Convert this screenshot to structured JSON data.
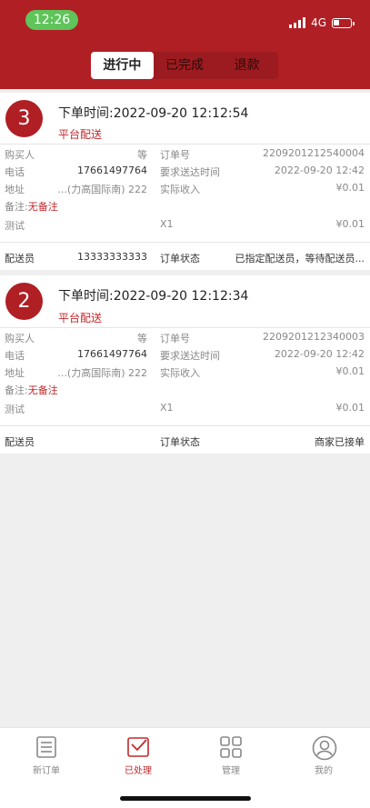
{
  "status_bar": {
    "time": "12:26",
    "network": "4G"
  },
  "tabs": [
    {
      "label": "进行中",
      "active": true
    },
    {
      "label": "已完成",
      "active": false
    },
    {
      "label": "退款",
      "active": false
    }
  ],
  "labels": {
    "buyer": "购买人",
    "phone": "电话",
    "address": "地址",
    "remark": "备注:",
    "order_no": "订单号",
    "required_time": "要求送达时间",
    "actual_income": "实际收入",
    "courier": "配送员",
    "order_status": "订单状态"
  },
  "orders": [
    {
      "number": "3",
      "order_time": "下单时间:2022-09-20 12:12:54",
      "delivery_type": "平台配送",
      "buyer": "等",
      "phone": "17661497764",
      "address": "...(力高国际南) 222",
      "remark": "无备注",
      "order_no": "2209201212540004",
      "required_time": "2022-09-20 12:42",
      "actual_income": "¥0.01",
      "item_name": "测试",
      "item_qty": "X1",
      "item_price": "¥0.01",
      "courier": "13333333333",
      "status": "已指定配送员，等待配送员..."
    },
    {
      "number": "2",
      "order_time": "下单时间:2022-09-20 12:12:34",
      "delivery_type": "平台配送",
      "buyer": "等",
      "phone": "17661497764",
      "address": "...(力高国际南) 222",
      "remark": "无备注",
      "order_no": "2209201212340003",
      "required_time": "2022-09-20 12:42",
      "actual_income": "¥0.01",
      "item_name": "测试",
      "item_qty": "X1",
      "item_price": "¥0.01",
      "courier": "",
      "status": "商家已接单"
    }
  ],
  "bottom_nav": [
    {
      "label": "新订单",
      "icon": "list-icon",
      "active": false
    },
    {
      "label": "已处理",
      "icon": "check-box-icon",
      "active": true
    },
    {
      "label": "管理",
      "icon": "grid-icon",
      "active": false
    },
    {
      "label": "我的",
      "icon": "user-icon",
      "active": false
    }
  ],
  "colors": {
    "brand": "#b01f24",
    "accent_text": "#c2282c",
    "status_time_bg": "#5fc45a"
  }
}
